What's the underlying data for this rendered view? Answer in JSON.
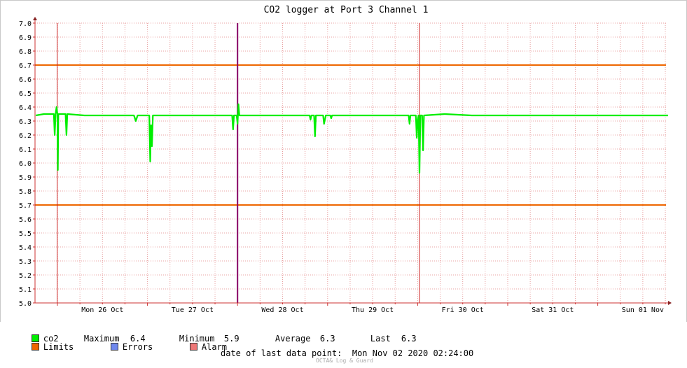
{
  "chart_data": {
    "type": "line",
    "title": "CO2 logger at Port 3 Channel 1",
    "ylim": [
      5.0,
      7.0
    ],
    "y_ticks": [
      "5.0",
      "5.1",
      "5.2",
      "5.3",
      "5.4",
      "5.5",
      "5.6",
      "5.7",
      "5.8",
      "5.9",
      "6.0",
      "6.1",
      "6.2",
      "6.3",
      "6.4",
      "6.5",
      "6.6",
      "6.7",
      "6.8",
      "6.9",
      "7.0"
    ],
    "x_ticks": [
      {
        "label": "Mon 26 Oct",
        "day": 1
      },
      {
        "label": "Tue 27 Oct",
        "day": 2
      },
      {
        "label": "Wed 28 Oct",
        "day": 3
      },
      {
        "label": "Thu 29 Oct",
        "day": 4
      },
      {
        "label": "Fri 30 Oct",
        "day": 5
      },
      {
        "label": "Sat 31 Oct",
        "day": 6
      },
      {
        "label": "Sun 01 Nov",
        "day": 7
      }
    ],
    "xlim_days": [
      0.76,
      7.78
    ],
    "limits": [
      6.7,
      5.7
    ],
    "alarm_days": [
      0.998,
      5.02
    ],
    "event_days": [
      3.0
    ],
    "series": [
      {
        "name": "co2",
        "points": [
          [
            0.76,
            6.34
          ],
          [
            0.85,
            6.35
          ],
          [
            0.94,
            6.35
          ],
          [
            0.96,
            6.35
          ],
          [
            0.97,
            6.2
          ],
          [
            0.98,
            6.35
          ],
          [
            0.99,
            6.4
          ],
          [
            1.0,
            6.35
          ],
          [
            1.005,
            5.95
          ],
          [
            1.01,
            6.35
          ],
          [
            1.05,
            6.35
          ],
          [
            1.09,
            6.35
          ],
          [
            1.1,
            6.2
          ],
          [
            1.11,
            6.35
          ],
          [
            1.3,
            6.34
          ],
          [
            1.6,
            6.34
          ],
          [
            1.85,
            6.34
          ],
          [
            1.87,
            6.3
          ],
          [
            1.89,
            6.34
          ],
          [
            2.0,
            6.34
          ],
          [
            2.02,
            6.34
          ],
          [
            2.03,
            6.01
          ],
          [
            2.04,
            6.27
          ],
          [
            2.05,
            6.12
          ],
          [
            2.06,
            6.34
          ],
          [
            2.3,
            6.34
          ],
          [
            2.6,
            6.34
          ],
          [
            2.9,
            6.34
          ],
          [
            2.94,
            6.34
          ],
          [
            2.95,
            6.24
          ],
          [
            2.96,
            6.34
          ],
          [
            2.99,
            6.34
          ],
          [
            3.0,
            6.28
          ],
          [
            3.01,
            6.42
          ],
          [
            3.02,
            6.34
          ],
          [
            3.3,
            6.34
          ],
          [
            3.6,
            6.34
          ],
          [
            3.8,
            6.34
          ],
          [
            3.81,
            6.31
          ],
          [
            3.82,
            6.34
          ],
          [
            3.85,
            6.34
          ],
          [
            3.86,
            6.19
          ],
          [
            3.87,
            6.34
          ],
          [
            3.95,
            6.34
          ],
          [
            3.96,
            6.28
          ],
          [
            3.98,
            6.34
          ],
          [
            4.03,
            6.34
          ],
          [
            4.04,
            6.32
          ],
          [
            4.05,
            6.34
          ],
          [
            4.3,
            6.34
          ],
          [
            4.6,
            6.34
          ],
          [
            4.85,
            6.34
          ],
          [
            4.9,
            6.34
          ],
          [
            4.91,
            6.28
          ],
          [
            4.92,
            6.34
          ],
          [
            4.98,
            6.34
          ],
          [
            4.99,
            6.18
          ],
          [
            5.0,
            6.31
          ],
          [
            5.01,
            6.34
          ],
          [
            5.02,
            5.93
          ],
          [
            5.03,
            6.34
          ],
          [
            5.05,
            6.34
          ],
          [
            5.06,
            6.09
          ],
          [
            5.07,
            6.34
          ],
          [
            5.3,
            6.35
          ],
          [
            5.6,
            6.34
          ],
          [
            5.9,
            6.34
          ],
          [
            6.2,
            6.34
          ],
          [
            6.5,
            6.34
          ],
          [
            6.8,
            6.34
          ],
          [
            7.1,
            6.34
          ],
          [
            7.4,
            6.34
          ],
          [
            7.6,
            6.34
          ],
          [
            7.78,
            6.34
          ]
        ]
      }
    ]
  },
  "legend": {
    "co2": {
      "name": "co2",
      "max_label": "Maximum",
      "max_value": "6.4",
      "min_label": "Minimum",
      "min_value": "5.9",
      "avg_label": "Average",
      "avg_value": "6.3",
      "last_label": "Last",
      "last_value": "6.3"
    },
    "limits_label": "Limits",
    "errors_label": "Errors",
    "alarm_label": "Alarm"
  },
  "footer": {
    "last_point_label": "date of last data point:",
    "last_point_value": "Mon Nov 02 2020 02:24:00",
    "watermark": "OCTA& Log & Guard"
  },
  "colors": {
    "series": "#00ee00",
    "limits": "#ee6600",
    "errors": "#6f88ee",
    "alarm": "#ee7777",
    "alarm_line": "#cc2222",
    "event_line": "#880066",
    "grid": "#e8a0a0"
  }
}
